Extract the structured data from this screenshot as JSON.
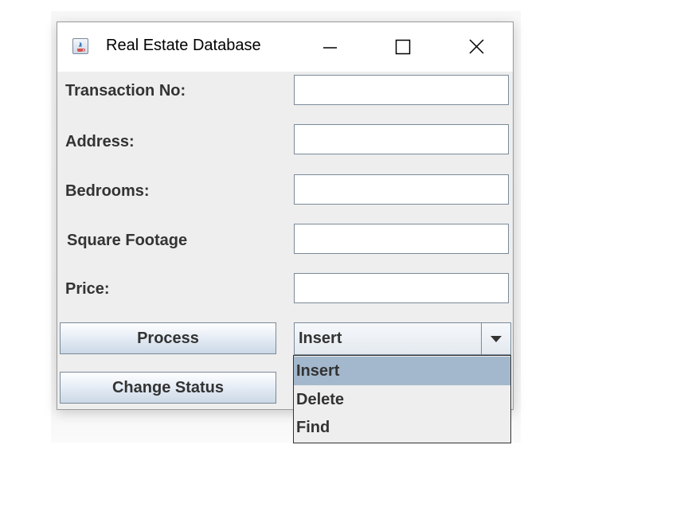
{
  "window": {
    "title": "Real Estate Database",
    "app_icon": "java-cup-icon",
    "controls": [
      "minimize-icon",
      "maximize-icon",
      "close-icon"
    ]
  },
  "form": {
    "fields": [
      {
        "label": "Transaction No:",
        "value": ""
      },
      {
        "label": "Address:",
        "value": ""
      },
      {
        "label": "Bedrooms:",
        "value": ""
      },
      {
        "label": "Square Footage",
        "value": ""
      },
      {
        "label": "Price:",
        "value": ""
      }
    ],
    "process_label": "Process",
    "change_status_label": "Change Status",
    "operation": {
      "selected": "Insert",
      "options": [
        "Insert",
        "Delete",
        "Find"
      ],
      "highlighted": "Insert"
    }
  },
  "colors": {
    "window_bg": "#eeeeee",
    "titlebar_bg": "#ffffff",
    "selection_bg": "#a3b8cc",
    "text": "#333333"
  }
}
